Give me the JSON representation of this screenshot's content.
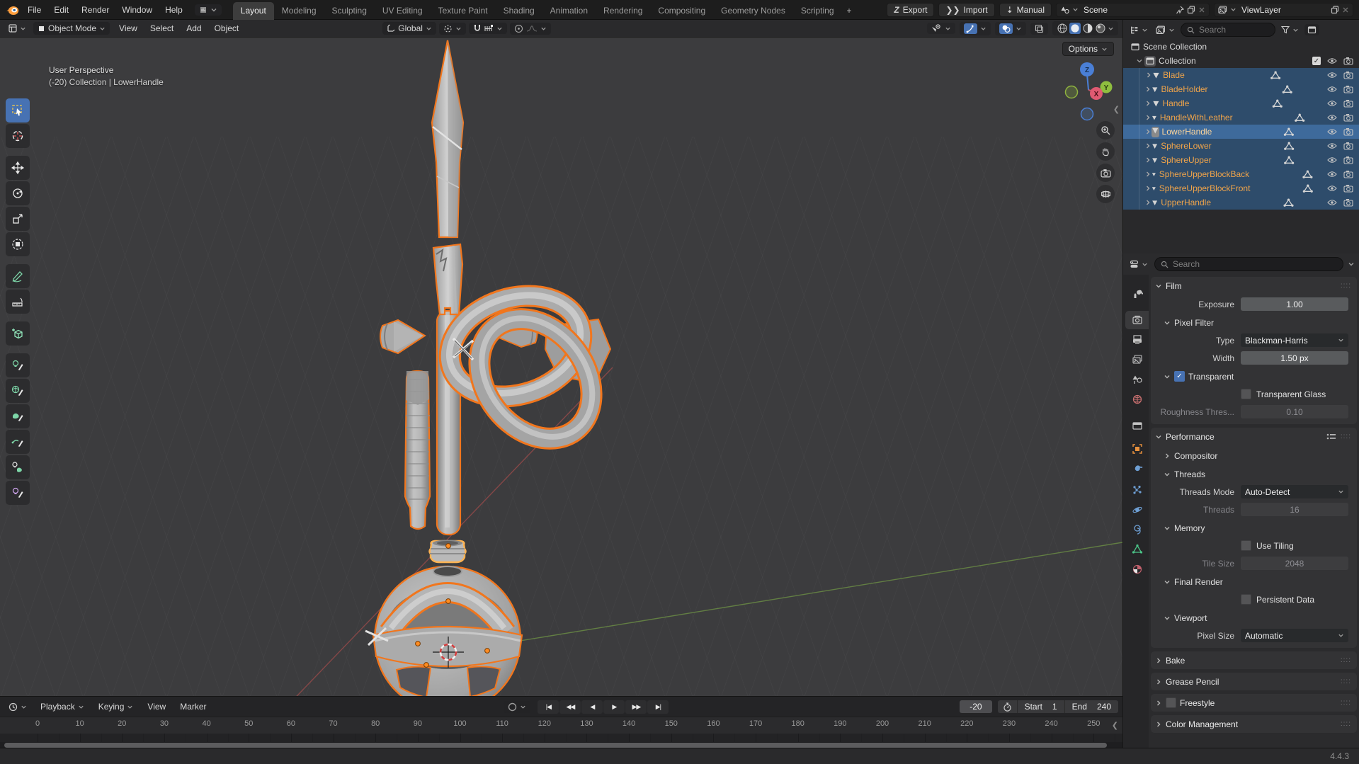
{
  "topbar": {
    "menus": [
      "File",
      "Edit",
      "Render",
      "Window",
      "Help"
    ],
    "workspaces": [
      "Layout",
      "Modeling",
      "Sculpting",
      "UV Editing",
      "Texture Paint",
      "Shading",
      "Animation",
      "Rendering",
      "Compositing",
      "Geometry Nodes",
      "Scripting"
    ],
    "active_workspace": "Layout",
    "add_workspace_label": "+",
    "export_label": "Export",
    "import_label": "Import",
    "manual_label": "Manual",
    "scene_name": "Scene",
    "viewlayer_name": "ViewLayer"
  },
  "viewport_header": {
    "mode": "Object Mode",
    "menus": [
      "View",
      "Select",
      "Add",
      "Object"
    ],
    "orientation": "Global",
    "options_label": "Options"
  },
  "toolbar_tools": [
    "select-box",
    "cursor",
    "move",
    "rotate",
    "scale",
    "transform",
    "annotate",
    "measure",
    "add-cube",
    "lamp-paint",
    "environment-paint",
    "surface-paint",
    "curve-paint",
    "lamp-group-paint",
    "shadow-paint"
  ],
  "viewport": {
    "overlay_line1": "User Perspective",
    "overlay_line2": "(-20) Collection | LowerHandle",
    "gizmo": {
      "x": "X",
      "y": "Y",
      "z": "Z"
    }
  },
  "outliner": {
    "search_placeholder": "Search",
    "scene_collection_label": "Scene Collection",
    "collection_label": "Collection",
    "objects": [
      {
        "label": "Blade"
      },
      {
        "label": "BladeHolder"
      },
      {
        "label": "Handle"
      },
      {
        "label": "HandleWithLeather"
      },
      {
        "label": "LowerHandle",
        "active": true
      },
      {
        "label": "SphereLower"
      },
      {
        "label": "SphereUpper"
      },
      {
        "label": "SphereUpperBlockBack"
      },
      {
        "label": "SphereUpperBlockFront"
      },
      {
        "label": "UpperHandle"
      }
    ]
  },
  "properties": {
    "search_placeholder": "Search",
    "tabs": [
      "tool",
      "render",
      "output",
      "view-layer",
      "scene",
      "world",
      "collection",
      "object",
      "modifiers",
      "particles",
      "physics",
      "constraints",
      "object-data",
      "material"
    ],
    "active_tab": "render",
    "panels": [
      {
        "label": "Film",
        "expanded": true,
        "grip": true,
        "rows": [
          {
            "type": "number",
            "label": "Exposure",
            "value": "1.00"
          },
          {
            "type": "subheader",
            "label": "Pixel Filter",
            "expanded": true
          },
          {
            "type": "select",
            "label": "Type",
            "value": "Blackman-Harris"
          },
          {
            "type": "number",
            "label": "Width",
            "value": "1.50 px"
          },
          {
            "type": "subheader",
            "label": "Transparent",
            "expanded": true,
            "checkbox": true,
            "checked": true
          },
          {
            "type": "checkbox",
            "label": "Transparent Glass",
            "checked": false
          },
          {
            "type": "number",
            "label": "Roughness Thres...",
            "value": "0.10",
            "disabled": true
          }
        ]
      },
      {
        "label": "Performance",
        "expanded": true,
        "grip": true,
        "list_icon": true,
        "rows": [
          {
            "type": "subheader",
            "label": "Compositor",
            "expanded": false
          },
          {
            "type": "subheader",
            "label": "Threads",
            "expanded": true
          },
          {
            "type": "select",
            "label": "Threads Mode",
            "value": "Auto-Detect"
          },
          {
            "type": "number",
            "label": "Threads",
            "value": "16",
            "disabled": true
          },
          {
            "type": "subheader",
            "label": "Memory",
            "expanded": true
          },
          {
            "type": "checkbox",
            "label": "Use Tiling",
            "checked": false
          },
          {
            "type": "number",
            "label": "Tile Size",
            "value": "2048",
            "disabled": true
          },
          {
            "type": "subheader",
            "label": "Final Render",
            "expanded": true
          },
          {
            "type": "checkbox",
            "label": "Persistent Data",
            "checked": false
          },
          {
            "type": "subheader",
            "label": "Viewport",
            "expanded": true
          },
          {
            "type": "select",
            "label": "Pixel Size",
            "value": "Automatic"
          }
        ]
      },
      {
        "label": "Bake",
        "expanded": false,
        "grip": true,
        "rows": []
      },
      {
        "label": "Grease Pencil",
        "expanded": false,
        "grip": true,
        "rows": []
      },
      {
        "label": "Freestyle",
        "expanded": false,
        "grip": true,
        "checkbox": true,
        "checked": false,
        "rows": []
      },
      {
        "label": "Color Management",
        "expanded": false,
        "grip": true,
        "rows": []
      }
    ]
  },
  "timeline": {
    "menus": [
      "Playback",
      "Keying",
      "View",
      "Marker"
    ],
    "current_frame": "-20",
    "start_label": "Start",
    "start_value": "1",
    "end_label": "End",
    "end_value": "240",
    "ticks": [
      0,
      10,
      20,
      30,
      40,
      50,
      60,
      70,
      80,
      90,
      100,
      110,
      120,
      130,
      140,
      150,
      160,
      170,
      180,
      190,
      200,
      210,
      220,
      230,
      240,
      250
    ],
    "transport": [
      "jump-to-start",
      "jump-to-prev-keyframe",
      "play-reverse",
      "play",
      "jump-to-next-keyframe",
      "jump-to-end"
    ]
  },
  "statusbar": {
    "version": "4.4.3"
  },
  "colors": {
    "accent_blue": "#4772b3",
    "selected_outline": "#f1761d",
    "active_outline": "#ffb352",
    "outliner_object_text": "#f0a44a",
    "outliner_active_text": "#ffd79c",
    "mesh_data_icon": "#43d6a5",
    "object_icon": "#d79a66",
    "world_icon": "#c96f6f",
    "modifier_icon": "#6e9fd4",
    "data_icon_green": "#4bc488",
    "material_icon": "#c2606c"
  }
}
